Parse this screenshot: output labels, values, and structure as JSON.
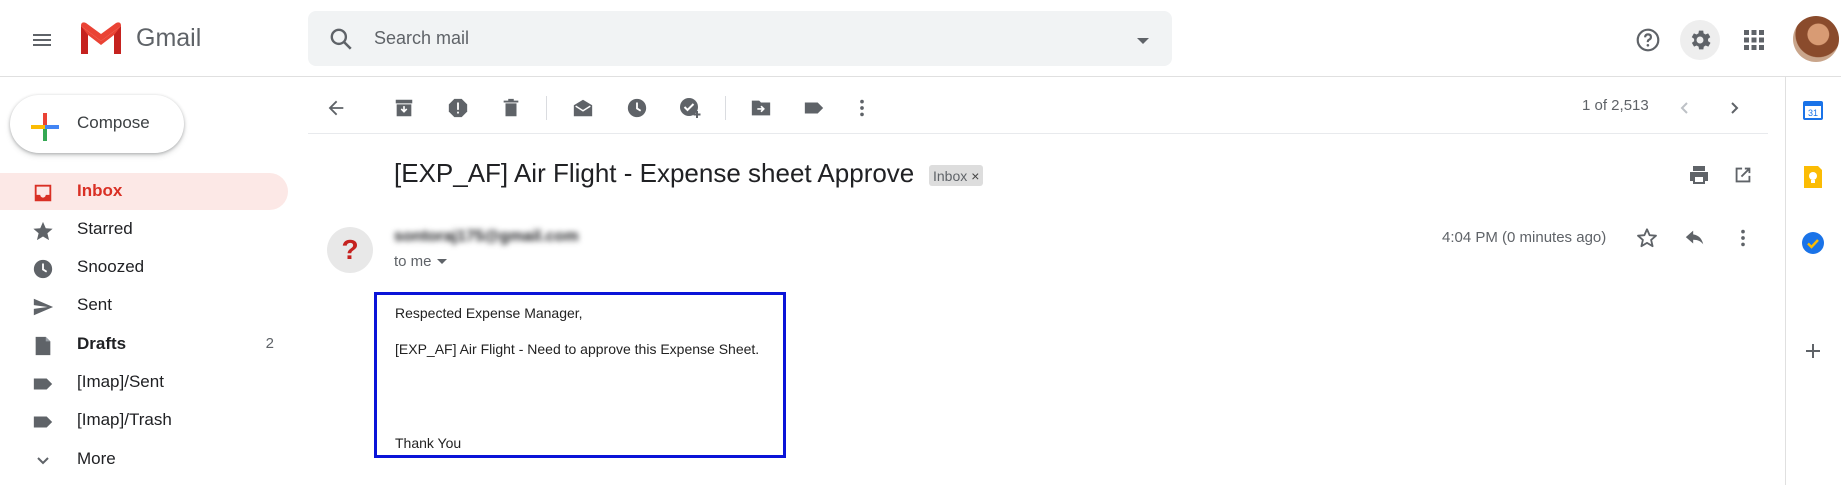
{
  "app": {
    "name": "Gmail"
  },
  "search": {
    "placeholder": "Search mail"
  },
  "compose": {
    "label": "Compose"
  },
  "nav": [
    {
      "label": "Inbox",
      "count": ""
    },
    {
      "label": "Starred",
      "count": ""
    },
    {
      "label": "Snoozed",
      "count": ""
    },
    {
      "label": "Sent",
      "count": ""
    },
    {
      "label": "Drafts",
      "count": "2"
    },
    {
      "label": "[Imap]/Sent",
      "count": ""
    },
    {
      "label": "[Imap]/Trash",
      "count": ""
    },
    {
      "label": "More",
      "count": ""
    }
  ],
  "toolbar": {
    "pager": "1 of 2,513"
  },
  "message": {
    "subject": "[EXP_AF] Air Flight - Expense sheet Approve",
    "label_badge": "Inbox",
    "label_badge_close": "×",
    "avatar_letter": "?",
    "sender": "sontoraj175@gmail.com",
    "to": "to me",
    "time": "4:04 PM (0 minutes ago)",
    "body": {
      "greeting": "Respected Expense Manager,",
      "line1": "[EXP_AF] Air Flight - Need to approve this Expense Sheet.",
      "closing": "Thank You"
    }
  },
  "side_panel": {
    "calendar_day": "31"
  },
  "colors": {
    "accent_red": "#d93025",
    "active_nav_bg": "#fce8e6",
    "highlight_box": "#0a14d8"
  }
}
